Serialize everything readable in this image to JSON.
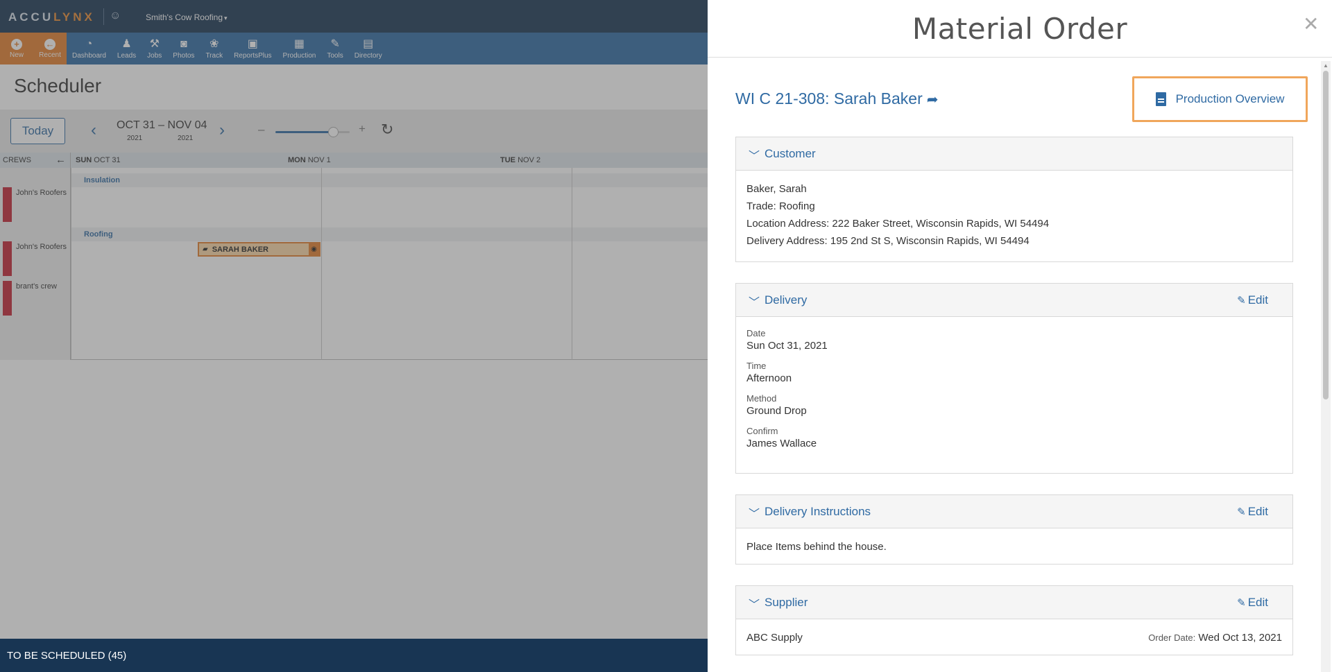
{
  "app": {
    "logo_part1": "ACCU",
    "logo_part2": "LYNX",
    "logo_icon": "lynx-cat-icon",
    "company": "Smith's Cow Roofing",
    "nav": [
      {
        "label": "New",
        "icon": "plus-circle-icon"
      },
      {
        "label": "Recent",
        "icon": "arrow-left-circle-icon"
      },
      {
        "label": "Dashboard",
        "icon": "gauge-icon"
      },
      {
        "label": "Leads",
        "icon": "person-icon"
      },
      {
        "label": "Jobs",
        "icon": "hammer-icon"
      },
      {
        "label": "Photos",
        "icon": "camera-icon"
      },
      {
        "label": "Track",
        "icon": "paw-icon"
      },
      {
        "label": "ReportsPlus",
        "icon": "report-icon"
      },
      {
        "label": "Production",
        "icon": "calendar-icon"
      },
      {
        "label": "Tools",
        "icon": "wrench-icon"
      },
      {
        "label": "Directory",
        "icon": "book-icon"
      }
    ]
  },
  "scheduler": {
    "title": "Scheduler",
    "today_label": "Today",
    "date_range": "OCT 31 – NOV 04",
    "year_start": "2021",
    "year_end": "2021",
    "zoom_minus": "–",
    "zoom_plus": "+",
    "zoom_level": 0.78,
    "crews_header": "CREWS",
    "days": [
      {
        "dow": "SUN",
        "date": "OCT 31"
      },
      {
        "dow": "MON",
        "date": "NOV 1"
      },
      {
        "dow": "TUE",
        "date": "NOV 2"
      }
    ],
    "groups": [
      "Insulation",
      "Roofing"
    ],
    "crews": [
      "John's Roofers",
      "John's Roofers",
      "brant's crew"
    ],
    "event_label": "SARAH BAKER",
    "to_be_scheduled": "TO BE SCHEDULED (45)"
  },
  "panel": {
    "title": "Material Order",
    "job_link": "WI C 21-308: Sarah Baker",
    "production_overview": "Production Overview",
    "customer": {
      "header": "Customer",
      "name": "Baker, Sarah",
      "trade": "Trade: Roofing",
      "location": "Location Address: 222 Baker Street, Wisconsin Rapids, WI 54494",
      "delivery_address": "Delivery Address: 195 2nd St S, Wisconsin Rapids, WI 54494"
    },
    "delivery": {
      "header": "Delivery",
      "edit": "Edit",
      "date_label": "Date",
      "date_value": "Sun Oct 31, 2021",
      "time_label": "Time",
      "time_value": "Afternoon",
      "method_label": "Method",
      "method_value": "Ground Drop",
      "confirm_label": "Confirm",
      "confirm_value": "James Wallace"
    },
    "instructions": {
      "header": "Delivery Instructions",
      "edit": "Edit",
      "text": "Place Items behind the house."
    },
    "supplier": {
      "header": "Supplier",
      "edit": "Edit",
      "name": "ABC Supply",
      "order_date_label": "Order Date:",
      "order_date_value": "Wed Oct 13, 2021"
    }
  },
  "colors": {
    "navy": "#183553",
    "blue": "#2f6aa3",
    "orange": "#e37f2c",
    "crew_red": "#c42433",
    "highlight": "#f0a65b"
  }
}
